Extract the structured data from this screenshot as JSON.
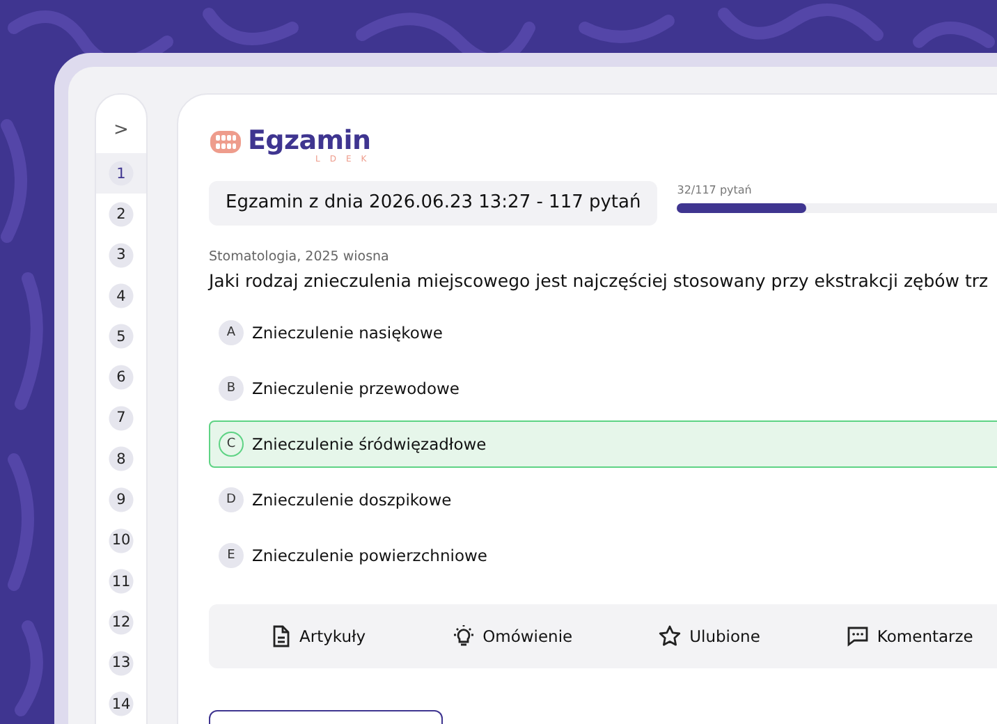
{
  "logo": {
    "name": "Egzamin",
    "subtitle": "LDEK"
  },
  "exam": {
    "title": "Egzamin z dnia 2026.06.23 13:27 - 117 pytań",
    "progress_label": "32/117 pytań",
    "level": 0.27
  },
  "question": {
    "source": "Stomatologia, 2025 wiosna",
    "text": "Jaki rodzaj znieczulenia miejscowego jest najczęściej stosowany przy ekstrakcji zębów trz"
  },
  "answers": [
    {
      "letter": "A",
      "text": "Znieczulenie nasiękowe",
      "selected": false
    },
    {
      "letter": "B",
      "text": "Znieczulenie przewodowe",
      "selected": false
    },
    {
      "letter": "C",
      "text": "Znieczulenie śródwięzadłowe",
      "selected": true
    },
    {
      "letter": "D",
      "text": "Znieczulenie doszpikowe",
      "selected": false
    },
    {
      "letter": "E",
      "text": "Znieczulenie powierzchniowe",
      "selected": false
    }
  ],
  "actions": [
    {
      "kind": "document",
      "label": "Artykuły"
    },
    {
      "kind": "bulb",
      "label": "Omówienie"
    },
    {
      "kind": "star",
      "label": "Ulubione"
    },
    {
      "kind": "comment",
      "label": "Komentarze"
    }
  ],
  "sidebar": {
    "toggle": ">",
    "items": [
      {
        "label": "1",
        "selected": true
      },
      {
        "label": "2",
        "selected": false
      },
      {
        "label": "3",
        "selected": false
      },
      {
        "label": "4",
        "selected": false
      },
      {
        "label": "5",
        "selected": false
      },
      {
        "label": "6",
        "selected": false
      },
      {
        "label": "7",
        "selected": false
      },
      {
        "label": "8",
        "selected": false
      },
      {
        "label": "9",
        "selected": false
      },
      {
        "label": "10",
        "selected": false
      },
      {
        "label": "11",
        "selected": false
      },
      {
        "label": "12",
        "selected": false
      },
      {
        "label": "13",
        "selected": false
      },
      {
        "label": "14",
        "selected": false
      }
    ]
  }
}
